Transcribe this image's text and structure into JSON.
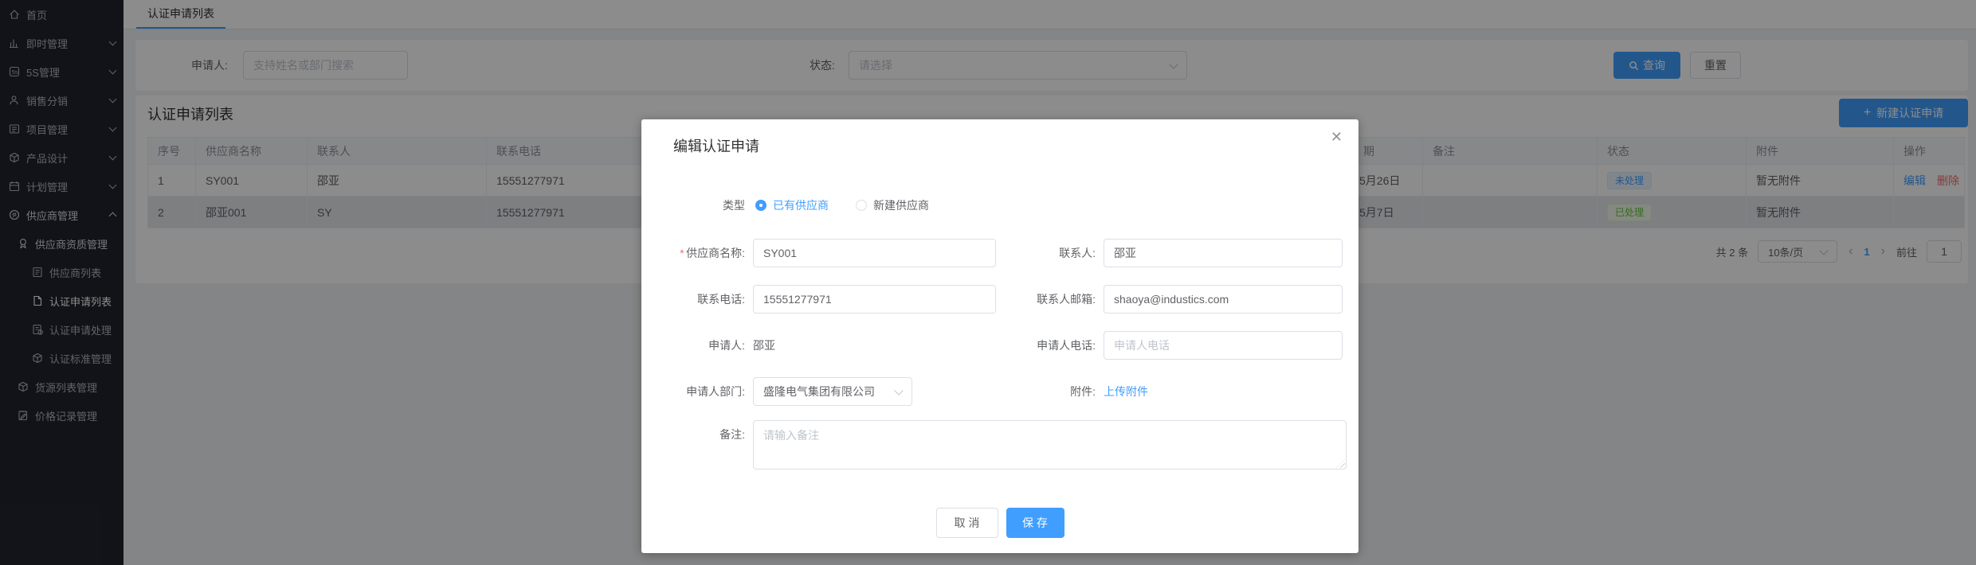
{
  "colors": {
    "primary": "#409EFF",
    "success": "#67C23A",
    "danger": "#F56C6C",
    "sidebar_bg": "#20242d"
  },
  "sidebar": {
    "items": [
      {
        "label": "首页",
        "icon": "home-icon"
      },
      {
        "label": "即时管理",
        "icon": "chart-icon",
        "arrow": "down"
      },
      {
        "label": "5S管理",
        "icon": "fives-icon",
        "arrow": "down"
      },
      {
        "label": "销售分销",
        "icon": "person-icon",
        "arrow": "down"
      },
      {
        "label": "项目管理",
        "icon": "list-icon",
        "arrow": "down"
      },
      {
        "label": "产品设计",
        "icon": "box-icon",
        "arrow": "down"
      },
      {
        "label": "计划管理",
        "icon": "calendar-icon",
        "arrow": "down"
      },
      {
        "label": "供应商管理",
        "icon": "supplier-icon",
        "arrow": "up",
        "expanded": true
      },
      {
        "label": "供应商资质管理",
        "icon": "badge-icon"
      },
      {
        "label": "供应商列表",
        "icon": "doc-list-icon"
      },
      {
        "label": "认证申请列表",
        "icon": "doc-icon",
        "active": true
      },
      {
        "label": "认证申请处理",
        "icon": "doc-clock-icon"
      },
      {
        "label": "认证标准管理",
        "icon": "cube-icon"
      },
      {
        "label": "货源列表管理",
        "icon": "cube-icon"
      },
      {
        "label": "价格记录管理",
        "icon": "notepad-icon"
      }
    ]
  },
  "tabbar": {
    "active_tab": "认证申请列表"
  },
  "filters": {
    "applicant_label": "申请人:",
    "applicant_placeholder": "支持姓名或部门搜索",
    "status_label": "状态:",
    "status_placeholder": "请选择",
    "search_button": "查询",
    "reset_button": "重置"
  },
  "list": {
    "title": "认证申请列表",
    "create_button": "新建认证申请",
    "columns": [
      "序号",
      "供应商名称",
      "联系人",
      "联系电话",
      "期",
      "备注",
      "状态",
      "附件",
      "操作"
    ],
    "rows": [
      {
        "no": "1",
        "name": "SY001",
        "contact": "邵亚",
        "phone": "15551277971",
        "date": "5月26日",
        "remark": "",
        "status": "未处理",
        "status_type": "pending",
        "attachment": "暂无附件",
        "edit": "编辑",
        "delete": "删除"
      },
      {
        "no": "2",
        "name": "邵亚001",
        "contact": "SY",
        "phone": "15551277971",
        "date": "5月7日",
        "remark": "",
        "status": "已处理",
        "status_type": "done",
        "attachment": "暂无附件"
      }
    ],
    "pagination": {
      "total": "共 2 条",
      "page_size": "10条/页",
      "current_page": "1",
      "goto_label": "前往",
      "goto_value": "1"
    }
  },
  "modal": {
    "title": "编辑认证申请",
    "close": "✕",
    "type_label": "类型",
    "radio_existing": "已有供应商",
    "radio_new": "新建供应商",
    "fields": {
      "supplier_label": "供应商名称:",
      "supplier_value": "SY001",
      "contact_label": "联系人:",
      "contact_value": "邵亚",
      "phone_label": "联系电话:",
      "phone_value": "15551277971",
      "email_label": "联系人邮箱:",
      "email_value": "shaoya@industics.com",
      "applicant_label": "申请人:",
      "applicant_value": "邵亚",
      "applicant_phone_label": "申请人电话:",
      "applicant_phone_placeholder": "申请人电话",
      "dept_label": "申请人部门:",
      "dept_value": "盛隆电气集团有限公司",
      "attachment_label": "附件:",
      "upload_link": "上传附件",
      "remark_label": "备注:",
      "remark_placeholder": "请输入备注"
    },
    "cancel_button": "取 消",
    "save_button": "保 存"
  }
}
